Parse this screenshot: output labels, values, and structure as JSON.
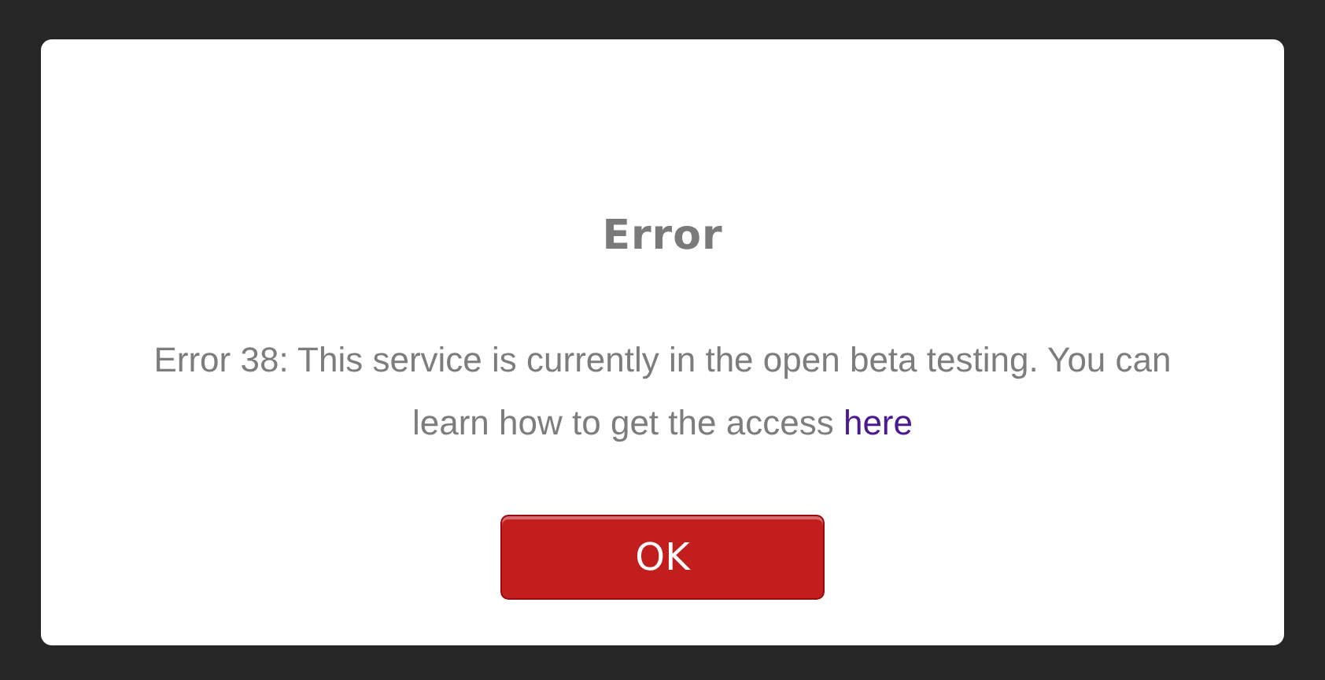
{
  "dialog": {
    "title": "Error",
    "message": "Error 38: This service is currently in the open beta testing. You can learn how to get the access",
    "link": "here",
    "buttons": [
      "OK"
    ]
  }
}
